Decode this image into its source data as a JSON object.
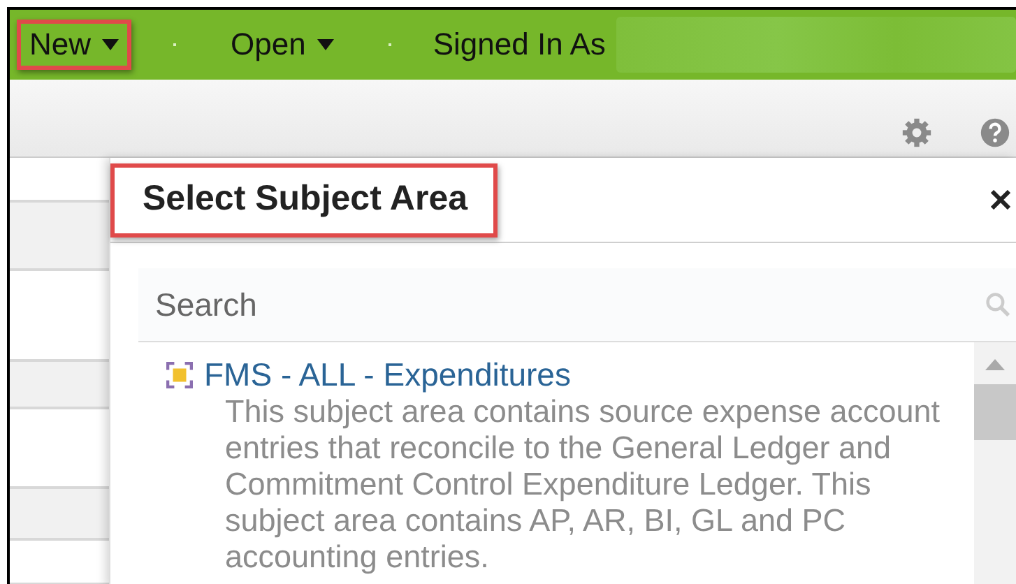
{
  "menu_bar": {
    "items": [
      {
        "label": "New",
        "highlighted": true
      },
      {
        "label": "Open",
        "highlighted": false
      }
    ],
    "signed_in_label": "Signed In As"
  },
  "dialog": {
    "title": "Select Subject Area",
    "title_highlighted": true,
    "search": {
      "placeholder": "Search"
    },
    "subject_areas": [
      {
        "name": "FMS - ALL - Expenditures",
        "description": "This subject area contains source expense account entries that reconcile to the General Ledger and Commitment Control Expenditure Ledger. This subject area contains AP, AR, BI, GL and PC accounting entries."
      }
    ]
  }
}
